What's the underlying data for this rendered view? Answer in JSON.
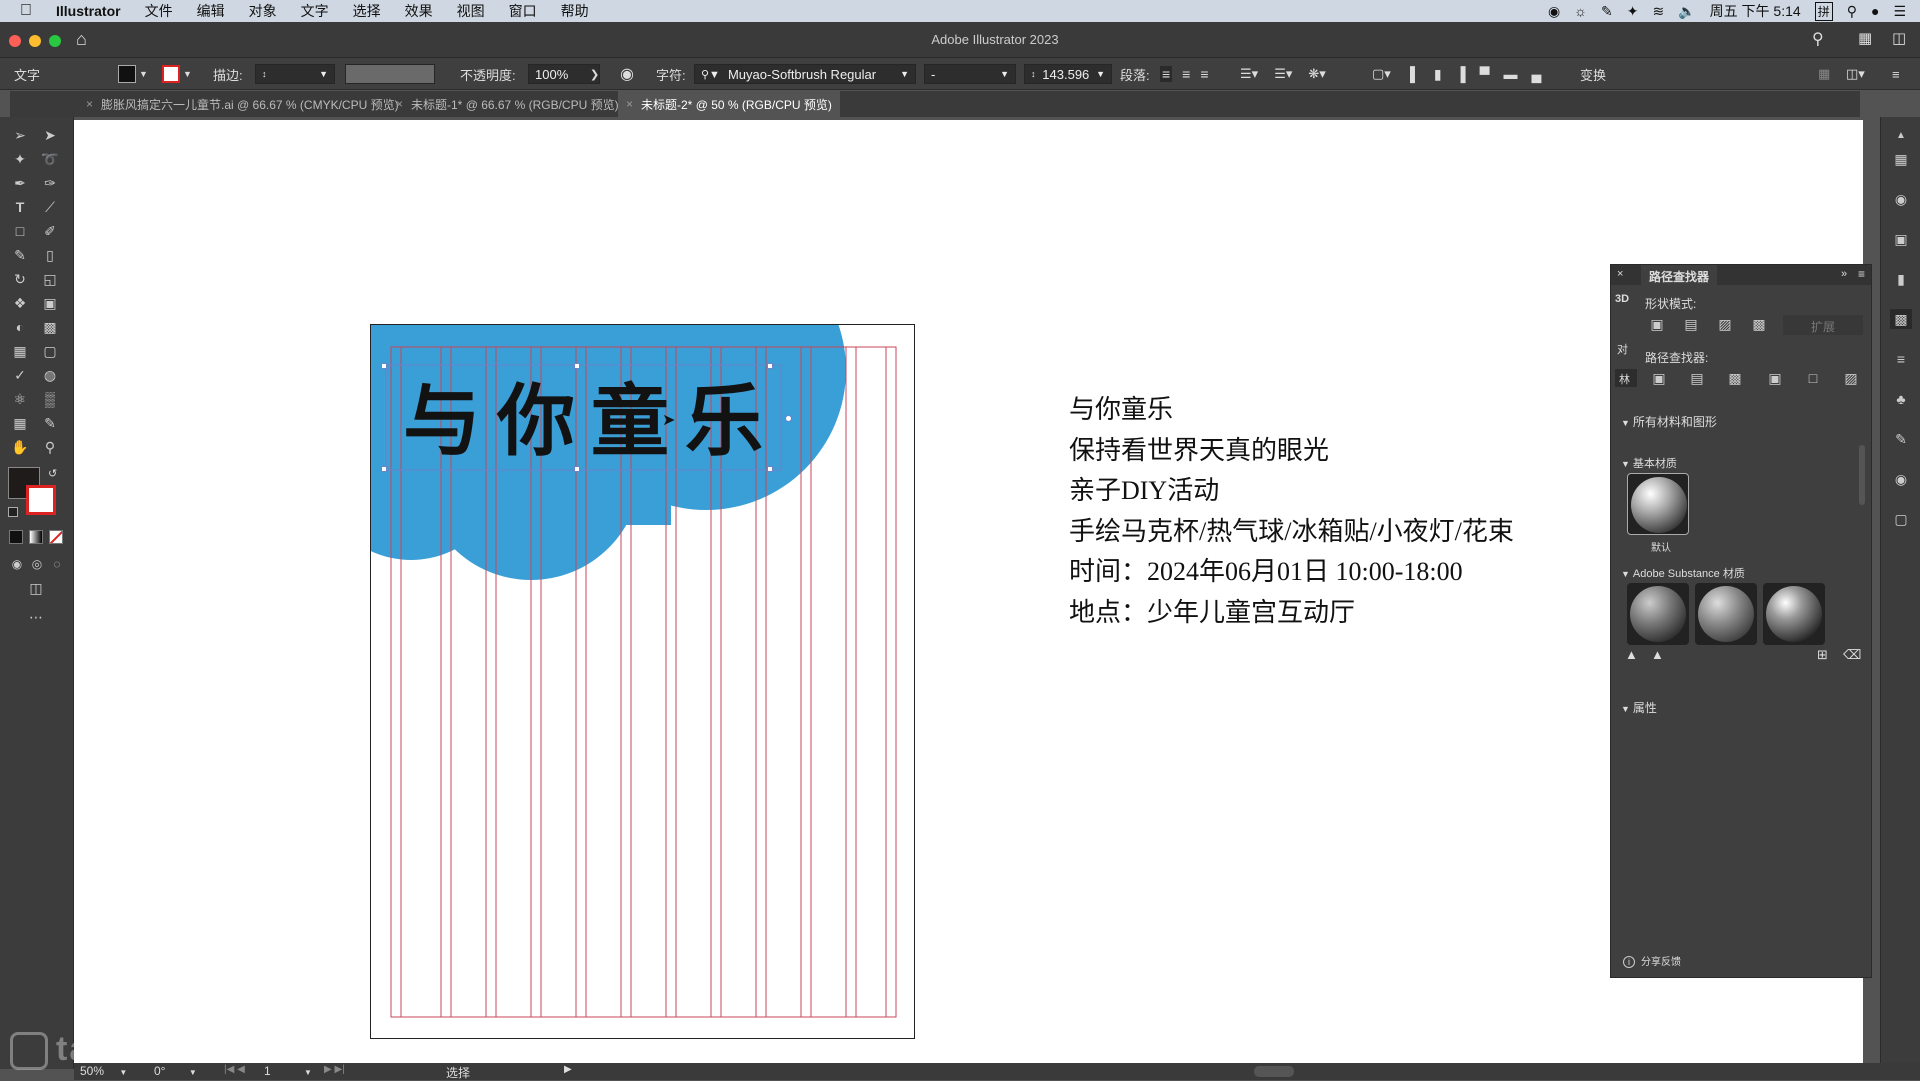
{
  "menubar": {
    "app": "Illustrator",
    "items": [
      "文件",
      "编辑",
      "对象",
      "文字",
      "选择",
      "效果",
      "视图",
      "窗口",
      "帮助"
    ],
    "clock": "周五 下午 5:14",
    "input_method": "拼"
  },
  "window": {
    "title": "Adobe Illustrator 2023"
  },
  "control": {
    "tool_name": "文字",
    "stroke_label": "描边:",
    "opacity_label": "不透明度:",
    "opacity_value": "100%",
    "char_label": "字符:",
    "font_family": "Muyao-Softbrush Regular",
    "font_style": "-",
    "font_size": "143.596",
    "para_label": "段落:",
    "transform_label": "变换"
  },
  "tabs": [
    {
      "label": "膨胀风搞定六一儿童节.ai @ 66.67 % (CMYK/CPU 预览)"
    },
    {
      "label": "未标题-1* @ 66.67 % (RGB/CPU 预览)"
    },
    {
      "label": "未标题-2* @ 50 % (RGB/CPU 预览)"
    }
  ],
  "artboard": {
    "headline": "与你童乐",
    "cloud_color": "#3a9fd6"
  },
  "poster_text": {
    "lines": [
      "与你童乐",
      "保持看世界天真的眼光",
      "亲子DIY活动",
      "手绘马克杯/热气球/冰箱贴/小夜灯/花束",
      "时间：2024年06月01日 10:00-18:00",
      "地点：少年儿童宫互动厅"
    ]
  },
  "pathfinder": {
    "title": "路径查找器",
    "side_tab_3d": "3D",
    "side_tab_align": "对",
    "side_tab_transform": "林",
    "shape_modes_label": "形状模式:",
    "expand_label": "扩展",
    "pathfinders_label": "路径查找器:",
    "all_materials_label": "所有材料和图形",
    "basic_materials_label": "基本材质",
    "default_label": "默认",
    "substance_label": "Adobe Substance 材质",
    "properties_label": "属性",
    "feedback_label": "分享反馈"
  },
  "status": {
    "zoom": "50%",
    "rotation": "0°",
    "artboard_num": "1",
    "mode": "选择"
  },
  "watermark": "tafe.cc"
}
